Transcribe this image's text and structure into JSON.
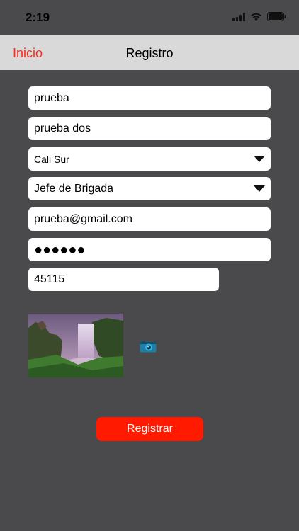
{
  "status_bar": {
    "time": "2:19"
  },
  "nav": {
    "back_label": "Inicio",
    "title": "Registro"
  },
  "form": {
    "first_name": "prueba",
    "last_name": "prueba dos",
    "zone": "Cali Sur",
    "role": "Jefe de Brigada",
    "email": "prueba@gmail.com",
    "password_masked": "●●●●●●",
    "code": "45115"
  },
  "buttons": {
    "register_label": "Registrar"
  },
  "icons": {
    "camera": "camera-icon",
    "dropdown": "triangle-down-icon"
  },
  "colors": {
    "accent": "#ff1a00",
    "background": "#4a4a4c",
    "nav_background": "#d9d9d9"
  }
}
